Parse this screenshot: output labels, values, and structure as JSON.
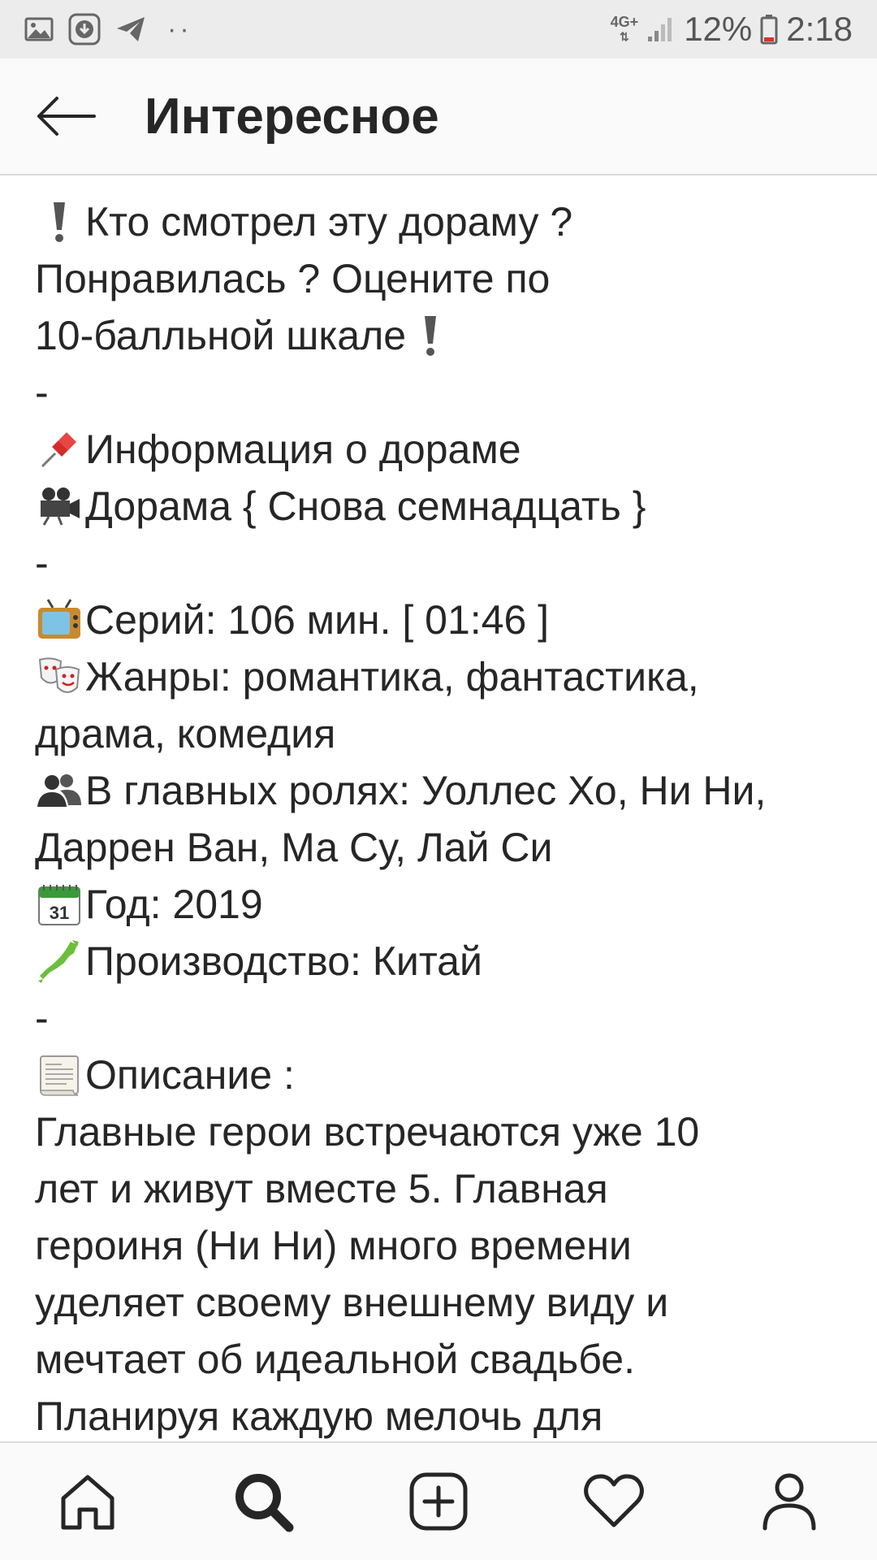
{
  "status_bar": {
    "network_type": "4G+",
    "battery": "12%",
    "time": "2:18",
    "dots": "··"
  },
  "header": {
    "title": "Интересное"
  },
  "caption": {
    "line1": "Кто смотрел эту дораму ?",
    "line2": "Понравилась ? Оцените по",
    "line3": "10-балльной шкале",
    "dash": "-",
    "info_heading": "Информация о дораме",
    "drama_title": "Дорама { Снова семнадцать }",
    "episodes": "Серий: 106 мин. [ 01:46 ]",
    "genres_1": "Жанры: романтика, фантастика,",
    "genres_2": "драма, комедия",
    "cast_1": "В главных ролях: Уоллес Хо, Ни Ни,",
    "cast_2": "Даррен Ван, Ма Су, Лай Си",
    "year": "Год: 2019",
    "production": "Производство: Китай",
    "description_heading": "Описание :",
    "desc_1": "Главные герои встречаются уже 10",
    "desc_2": "лет и живут вместе 5. Главная",
    "desc_3": "героиня (Ни Ни) много времени",
    "desc_4": "уделяет своему внешнему виду и",
    "desc_5": "мечтает об идеальной свадьбе.",
    "desc_6": "Планируя каждую мелочь для",
    "calendar_day": "31"
  },
  "icons": {
    "exclamation": "exclamation-icon",
    "pushpin": "pushpin-icon",
    "movie_camera": "movie-camera-icon",
    "tv": "television-icon",
    "masks": "theater-masks-icon",
    "people": "people-icon",
    "calendar": "calendar-icon",
    "map": "japan-map-icon",
    "scroll": "page-scroll-icon"
  },
  "colors": {
    "text": "#262626",
    "status_bar_bg": "#ececec",
    "header_bg": "#fafafa",
    "border": "#dbdbdb"
  }
}
